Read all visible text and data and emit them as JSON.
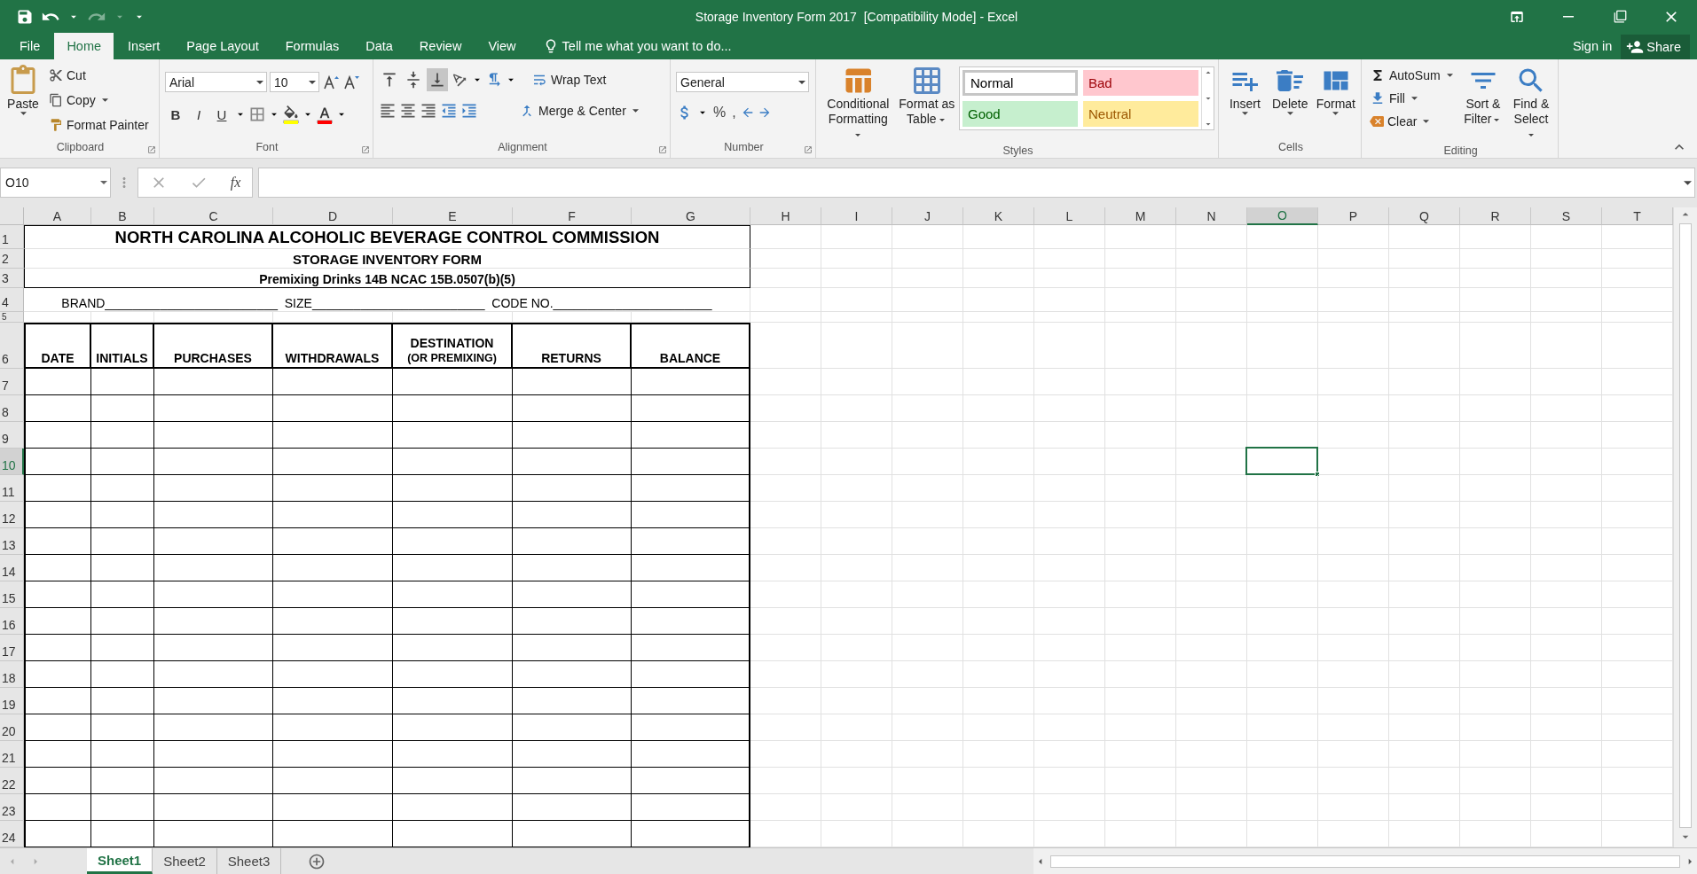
{
  "window": {
    "title": "Storage Inventory Form 2017  [Compatibility Mode] - Excel"
  },
  "ribbon_tabs": [
    {
      "label": "File",
      "selected": false
    },
    {
      "label": "Home",
      "selected": true
    },
    {
      "label": "Insert",
      "selected": false
    },
    {
      "label": "Page Layout",
      "selected": false
    },
    {
      "label": "Formulas",
      "selected": false
    },
    {
      "label": "Data",
      "selected": false
    },
    {
      "label": "Review",
      "selected": false
    },
    {
      "label": "View",
      "selected": false
    }
  ],
  "tell_me": {
    "placeholder": "Tell me what you want to do..."
  },
  "account": {
    "sign_in": "Sign in",
    "share": "Share"
  },
  "clipboard": {
    "label": "Clipboard",
    "paste": "Paste",
    "cut": "Cut",
    "copy": "Copy",
    "format_painter": "Format Painter"
  },
  "font": {
    "label": "Font",
    "name": "Arial",
    "size": "10",
    "bold": "B",
    "italic": "I",
    "underline": "U"
  },
  "alignment": {
    "label": "Alignment",
    "vertical": [
      {
        "selected": false
      },
      {
        "selected": false
      },
      {
        "selected": true
      }
    ],
    "wrap_text": "Wrap Text",
    "merge": "Merge & Center"
  },
  "number": {
    "label": "Number",
    "format": "General",
    "percent": "%",
    "comma": ","
  },
  "styles": {
    "label": "Styles",
    "conditional": "Conditional Formatting",
    "format_table": "Format as Table",
    "gallery": [
      {
        "label": "Normal",
        "kind": "normal",
        "selected": true
      },
      {
        "label": "Bad",
        "kind": "bad",
        "selected": false
      },
      {
        "label": "Good",
        "kind": "good",
        "selected": false
      },
      {
        "label": "Neutral",
        "kind": "neutral",
        "selected": false
      }
    ]
  },
  "cells": {
    "label": "Cells",
    "buttons": [
      "Insert",
      "Delete",
      "Format"
    ]
  },
  "editing": {
    "label": "Editing",
    "autosum": "AutoSum",
    "fill": "Fill",
    "clear": "Clear",
    "sort": "Sort & Filter",
    "find": "Find & Select"
  },
  "formula_bar": {
    "name_box": "O10",
    "function": "fx"
  },
  "sheet": {
    "columns": [
      {
        "label": "A",
        "selected": false
      },
      {
        "label": "B",
        "selected": false
      },
      {
        "label": "C",
        "selected": false
      },
      {
        "label": "D",
        "selected": false
      },
      {
        "label": "E",
        "selected": false
      },
      {
        "label": "F",
        "selected": false
      },
      {
        "label": "G",
        "selected": false
      },
      {
        "label": "H",
        "selected": false
      },
      {
        "label": "I",
        "selected": false
      },
      {
        "label": "J",
        "selected": false
      },
      {
        "label": "K",
        "selected": false
      },
      {
        "label": "L",
        "selected": false
      },
      {
        "label": "M",
        "selected": false
      },
      {
        "label": "N",
        "selected": false
      },
      {
        "label": "O",
        "selected": true
      },
      {
        "label": "P",
        "selected": false
      },
      {
        "label": "Q",
        "selected": false
      },
      {
        "label": "R",
        "selected": false
      },
      {
        "label": "S",
        "selected": false
      },
      {
        "label": "T",
        "selected": false
      }
    ],
    "rows": [
      {
        "label": "1",
        "selected": false,
        "kind": "title",
        "text": "NORTH CAROLINA ALCOHOLIC BEVERAGE CONTROL COMMISSION"
      },
      {
        "label": "2",
        "selected": false,
        "kind": "subtitle",
        "text": "STORAGE INVENTORY FORM"
      },
      {
        "label": "3",
        "selected": false,
        "kind": "regulation",
        "text": "Premixing Drinks 14B NCAC 15B.0507(b)(5)"
      },
      {
        "label": "4",
        "selected": false,
        "kind": "fields",
        "text": "BRAND_________________________  SIZE_________________________  CODE NO._______________________"
      },
      {
        "label": "5",
        "selected": false,
        "kind": "spacer"
      },
      {
        "label": "6",
        "selected": false,
        "kind": "header",
        "cells": [
          {
            "label": "DATE"
          },
          {
            "label": "INITIALS"
          },
          {
            "label": "PURCHASES"
          },
          {
            "label": "WITHDRAWALS"
          },
          {
            "label": "DESTINATION",
            "note": "(OR PREMIXING)"
          },
          {
            "label": "RETURNS"
          },
          {
            "label": "BALANCE"
          }
        ]
      },
      {
        "label": "7",
        "selected": false,
        "kind": "entry"
      },
      {
        "label": "8",
        "selected": false,
        "kind": "entry"
      },
      {
        "label": "9",
        "selected": false,
        "kind": "entry"
      },
      {
        "label": "10",
        "selected": true,
        "kind": "entry"
      },
      {
        "label": "11",
        "selected": false,
        "kind": "entry"
      },
      {
        "label": "12",
        "selected": false,
        "kind": "entry"
      },
      {
        "label": "13",
        "selected": false,
        "kind": "entry"
      },
      {
        "label": "14",
        "selected": false,
        "kind": "entry"
      },
      {
        "label": "15",
        "selected": false,
        "kind": "entry"
      },
      {
        "label": "16",
        "selected": false,
        "kind": "entry"
      },
      {
        "label": "17",
        "selected": false,
        "kind": "entry"
      },
      {
        "label": "18",
        "selected": false,
        "kind": "entry"
      },
      {
        "label": "19",
        "selected": false,
        "kind": "entry"
      },
      {
        "label": "20",
        "selected": false,
        "kind": "entry"
      },
      {
        "label": "21",
        "selected": false,
        "kind": "entry"
      },
      {
        "label": "22",
        "selected": false,
        "kind": "entry"
      },
      {
        "label": "23",
        "selected": false,
        "kind": "entry"
      },
      {
        "label": "24",
        "selected": false,
        "kind": "entry"
      }
    ]
  },
  "sheet_tabs": [
    {
      "label": "Sheet1",
      "selected": true
    },
    {
      "label": "Sheet2",
      "selected": false
    },
    {
      "label": "Sheet3",
      "selected": false
    }
  ]
}
